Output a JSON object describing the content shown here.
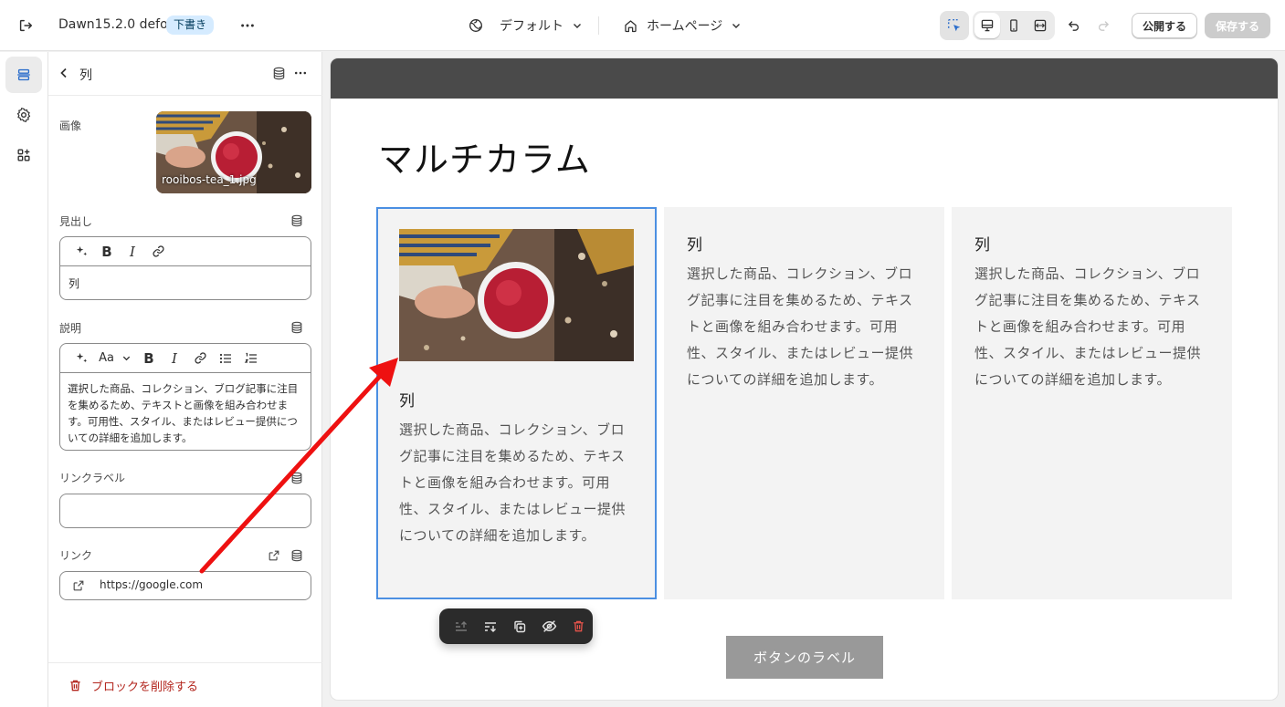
{
  "topbar": {
    "theme_name": "Dawn15.2.0 defo",
    "status_badge": "下書き",
    "theme_selector": "デフォルト",
    "page_selector": "ホームページ",
    "publish_label": "公開する",
    "save_label": "保存する"
  },
  "panel": {
    "title": "列",
    "image_label": "画像",
    "image_filename": "rooibos-tea_1.jpg",
    "heading_label": "見出し",
    "heading_value": "列",
    "heading_font_dropdown": "Aa",
    "description_label": "説明",
    "description_value": "選択した商品、コレクション、ブログ記事に注目を集めるため、テキストと画像を組み合わせます。可用性、スタイル、またはレビュー提供についての詳細を追加します。",
    "link_label_label": "リンクラベル",
    "link_label_value": "",
    "link_label": "リンク",
    "link_value": "https://google.com",
    "delete_block": "ブロックを削除する"
  },
  "preview": {
    "section_title": "マルチカラム",
    "columns": [
      {
        "title": "列",
        "text": "選択した商品、コレクション、ブログ記事に注目を集めるため、テキストと画像を組み合わせます。可用性、スタイル、またはレビュー提供についての詳細を追加します。",
        "has_image": true,
        "selected": true
      },
      {
        "title": "列",
        "text": "選択した商品、コレクション、ブログ記事に注目を集めるため、テキストと画像を組み合わせます。可用性、スタイル、またはレビュー提供についての詳細を追加します。",
        "has_image": false,
        "selected": false
      },
      {
        "title": "列",
        "text": "選択した商品、コレクション、ブログ記事に注目を集めるため、テキストと画像を組み合わせます。可用性、スタイル、またはレビュー提供についての詳細を追加します。",
        "has_image": false,
        "selected": false
      }
    ],
    "button_label": "ボタンのラベル"
  },
  "colors": {
    "selection_outline": "#4b8fe2",
    "annotation_arrow": "#ee1111",
    "badge_bg": "#d5ebff",
    "delete_red": "#b3261e"
  },
  "icons": [
    "exit-icon",
    "more-icon",
    "globe-icon",
    "chevron-down-icon",
    "home-icon",
    "select-cursor-icon",
    "desktop-icon",
    "mobile-icon",
    "fullwidth-icon",
    "undo-icon",
    "redo-icon",
    "sections-icon",
    "settings-icon",
    "apps-icon",
    "back-chevron-icon",
    "database-icon",
    "magic-icon",
    "bold-icon",
    "italic-icon",
    "link-icon",
    "bullet-list-icon",
    "numbered-list-icon",
    "external-link-icon",
    "trash-icon",
    "move-up-icon",
    "move-down-icon",
    "duplicate-icon",
    "hide-icon"
  ]
}
